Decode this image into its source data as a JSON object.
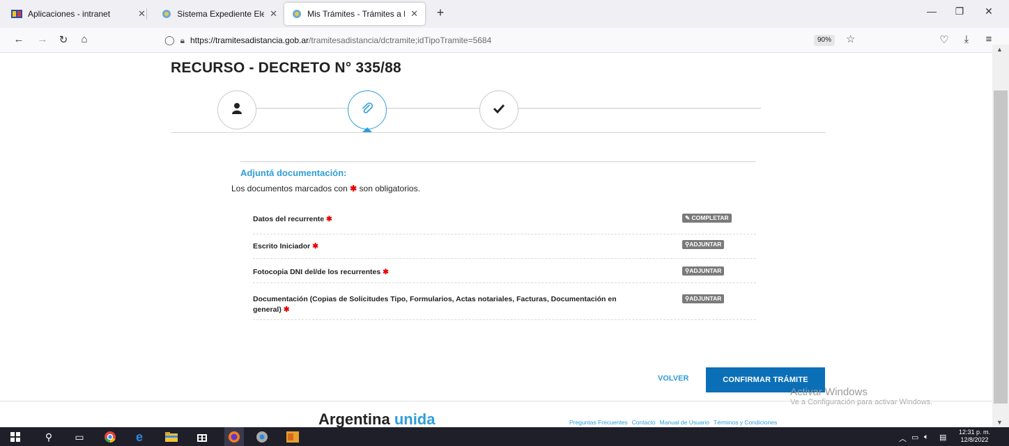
{
  "browser": {
    "tabs": [
      {
        "title": "Aplicaciones - intranet",
        "active": false
      },
      {
        "title": "Sistema Expediente Electrónico",
        "active": false
      },
      {
        "title": "Mis Trámites - Trámites a Distan",
        "active": true
      }
    ],
    "url_host": "https://tramitesadistancia.gob.ar",
    "url_path": "/tramitesadistancia/dctramite;idTipoTramite=5684",
    "zoom": "90%"
  },
  "page": {
    "title": "RECURSO - DECRETO N° 335/88",
    "steps": [
      "user-icon",
      "paperclip-icon",
      "check-icon"
    ],
    "section_heading": "Adjuntá documentación:",
    "section_desc_before": "Los documentos marcados con",
    "required_mark": "✱",
    "section_desc_after": "son obligatorios.",
    "documents": [
      {
        "label": "Datos del recurrente",
        "action": "COMPLETAR",
        "action_icon": "pencil-icon"
      },
      {
        "label": "Escrito Iniciador",
        "action": "ADJUNTAR",
        "action_icon": "paperclip-icon"
      },
      {
        "label": "Fotocopia DNI del/de los recurrentes",
        "action": "ADJUNTAR",
        "action_icon": "paperclip-icon"
      },
      {
        "label": "Documentación (Copias de Solicitudes Tipo, Formularios, Actas notariales, Facturas, Documentación en general)",
        "action": "ADJUNTAR",
        "action_icon": "paperclip-icon"
      }
    ],
    "back_button": "VOLVER",
    "confirm_button": "CONFIRMAR TRÁMITE"
  },
  "watermark": {
    "line1": "Activar Windows",
    "line2": "Ve a Configuración para activar Windows."
  },
  "footer": {
    "brand_main": "Argentina",
    "brand_accent": "unida",
    "links": [
      "Preguntas Frecuentes",
      "Contacto",
      "Manual de Usuario",
      "Términos y Condiciones"
    ]
  },
  "taskbar": {
    "time": "12:31 p. m.",
    "date": "12/8/2022"
  },
  "colors": {
    "accent": "#2f9ed8",
    "primary_button": "#0b6fb7",
    "required": "#e60000"
  }
}
